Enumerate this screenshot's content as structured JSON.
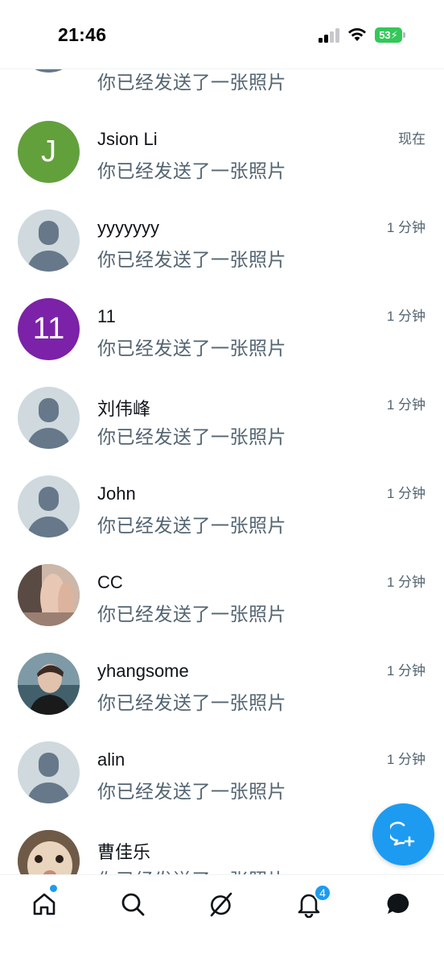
{
  "status_bar": {
    "time": "21:46",
    "battery": "53"
  },
  "conversations": [
    {
      "name": "",
      "preview": "你已经发送了一张照片",
      "time": "",
      "avatar": {
        "type": "default"
      }
    },
    {
      "name": "Jsion Li",
      "preview": "你已经发送了一张照片",
      "time": "现在",
      "avatar": {
        "type": "initial",
        "text": "J",
        "color": "#62a03c"
      }
    },
    {
      "name": "yyyyyyy",
      "preview": "你已经发送了一张照片",
      "time": "1 分钟",
      "avatar": {
        "type": "default"
      }
    },
    {
      "name": "11",
      "preview": "你已经发送了一张照片",
      "time": "1 分钟",
      "avatar": {
        "type": "initial",
        "text": "11",
        "color": "#7b22a8"
      }
    },
    {
      "name": "刘伟峰",
      "preview": "你已经发送了一张照片",
      "time": "1 分钟",
      "avatar": {
        "type": "default"
      }
    },
    {
      "name": "John",
      "preview": "你已经发送了一张照片",
      "time": "1 分钟",
      "avatar": {
        "type": "default"
      }
    },
    {
      "name": "CC",
      "preview": "你已经发送了一张照片",
      "time": "1 分钟",
      "avatar": {
        "type": "photo",
        "color": "#b89a8a"
      }
    },
    {
      "name": "yhangsome",
      "preview": "你已经发送了一张照片",
      "time": "1 分钟",
      "avatar": {
        "type": "photo",
        "color": "#3f5a66"
      }
    },
    {
      "name": "alin",
      "preview": "你已经发送了一张照片",
      "time": "1 分钟",
      "avatar": {
        "type": "default"
      }
    },
    {
      "name": "曹佳乐",
      "preview": "你已经发送了一张照片",
      "time": "",
      "avatar": {
        "type": "photo",
        "color": "#8d6a4f"
      }
    }
  ],
  "bottom_nav": {
    "items": [
      {
        "icon": "home-icon"
      },
      {
        "icon": "search-icon"
      },
      {
        "icon": "grok-icon"
      },
      {
        "icon": "notifications-icon"
      },
      {
        "icon": "messages-icon"
      }
    ],
    "notification_count": "4"
  },
  "colors": {
    "accent": "#1d9bf0",
    "secondary_text": "#536471",
    "default_avatar_bg": "#cfd9de"
  }
}
